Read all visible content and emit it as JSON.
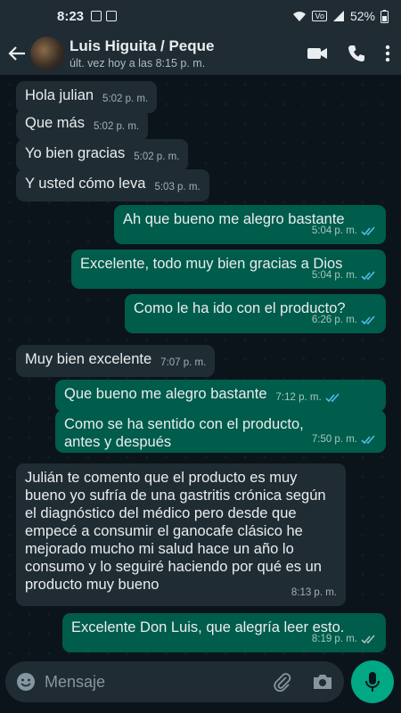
{
  "status": {
    "time": "8:23",
    "battery": "52%"
  },
  "header": {
    "contact_name": "Luis Higuita / Peque",
    "last_seen": "últ. vez hoy a las 8:15 p. m."
  },
  "messages": [
    {
      "dir": "in",
      "text": "Hola julian",
      "time": "5:02 p. m."
    },
    {
      "dir": "in",
      "text": "Que más",
      "time": "5:02 p. m."
    },
    {
      "dir": "in",
      "text": "Yo bien gracias",
      "time": "5:02 p. m."
    },
    {
      "dir": "in",
      "text": "Y usted cómo leva",
      "time": "5:03 p. m."
    },
    {
      "dir": "out",
      "text": "Ah que bueno me alegro bastante",
      "time": "5:04 p. m."
    },
    {
      "dir": "out",
      "text": "Excelente, todo muy bien gracias a Dios",
      "time": "5:04 p. m."
    },
    {
      "dir": "out",
      "text": "Como le ha ido con el producto?",
      "time": "6:26 p. m."
    },
    {
      "dir": "in",
      "text": "Muy bien excelente",
      "time": "7:07 p. m."
    },
    {
      "dir": "out",
      "text": "Que bueno me alegro bastante",
      "time": "7:12 p. m."
    },
    {
      "dir": "out",
      "text": "Como se ha sentido con el producto, antes y después",
      "time": "7:50 p. m."
    },
    {
      "dir": "in",
      "text": "Julián te comento que el producto es muy bueno  yo sufría de una gastritis crónica según el diagnóstico del médico pero desde que empecé a consumir el ganocafe clásico he mejorado mucho mi salud hace un año lo consumo y lo seguiré haciendo por qué es un producto muy bueno",
      "time": "8:13 p. m."
    },
    {
      "dir": "out",
      "text": "Excelente Don Luis, que alegría leer esto.",
      "time": "8:19 p. m."
    }
  ],
  "composer": {
    "placeholder": "Mensaje"
  },
  "colors": {
    "incoming": "#202c33",
    "outgoing": "#005c4b",
    "accent": "#00a884",
    "read_ticks": "#53bdeb"
  }
}
